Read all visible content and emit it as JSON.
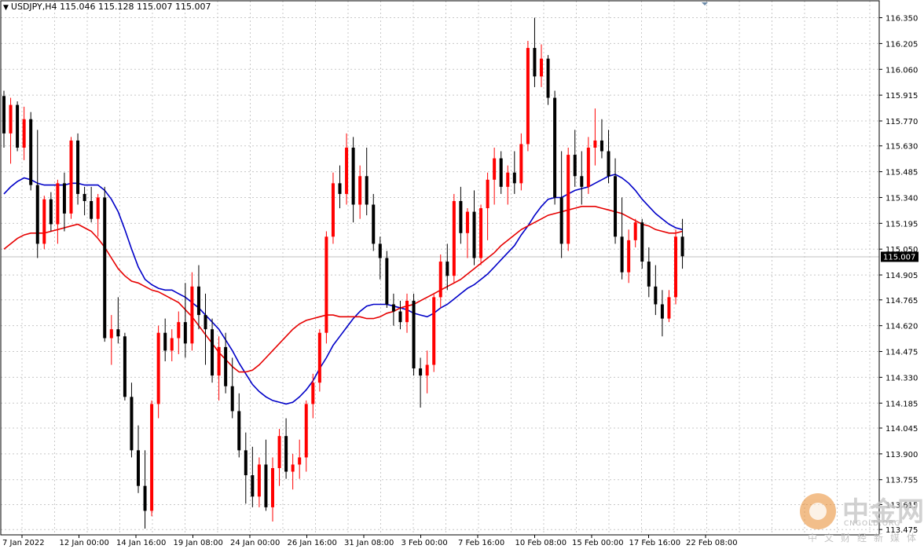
{
  "header": {
    "symbol": "USDJPY,H4",
    "ohlc": "115.046 115.128 115.007 115.007"
  },
  "colors": {
    "bull": "#ff0000",
    "bear": "#000000",
    "ma_fast": "#0000c8",
    "ma_slow": "#e60000",
    "grid": "#c8c8c8",
    "price_line": "#c0c0c0"
  },
  "watermark": {
    "cn": "中金网",
    "en": "CNGOLD.ORG",
    "sub": "中文财经新媒体"
  },
  "chart_data": {
    "type": "candlestick",
    "timeframe": "H4",
    "ylim": [
      113.445,
      116.445
    ],
    "y_ticks": [
      "116.350",
      "116.205",
      "116.060",
      "115.915",
      "115.770",
      "115.630",
      "115.485",
      "115.340",
      "115.195",
      "115.050",
      "114.905",
      "114.765",
      "114.620",
      "114.475",
      "114.330",
      "114.185",
      "114.045",
      "113.900",
      "113.755",
      "113.615",
      "113.475"
    ],
    "x_ticks": [
      "7 Jan 2022",
      "12 Jan 00:00",
      "14 Jan 16:00",
      "19 Jan 08:00",
      "24 Jan 00:00",
      "26 Jan 16:00",
      "31 Jan 08:00",
      "3 Feb 00:00",
      "7 Feb 16:00",
      "10 Feb 08:00",
      "15 Feb 00:00",
      "17 Feb 16:00",
      "22 Feb 08:00"
    ],
    "current_price": "115.007",
    "candles": [
      [
        115.91,
        115.94,
        115.62,
        115.7
      ],
      [
        115.7,
        115.9,
        115.53,
        115.86
      ],
      [
        115.86,
        115.88,
        115.6,
        115.62
      ],
      [
        115.62,
        115.85,
        115.55,
        115.78
      ],
      [
        115.78,
        115.82,
        115.38,
        115.41
      ],
      [
        115.41,
        115.72,
        115.0,
        115.08
      ],
      [
        115.08,
        115.35,
        115.05,
        115.33
      ],
      [
        115.33,
        115.37,
        115.15,
        115.19
      ],
      [
        115.19,
        115.44,
        115.08,
        115.42
      ],
      [
        115.42,
        115.48,
        115.15,
        115.25
      ],
      [
        115.25,
        115.68,
        115.22,
        115.66
      ],
      [
        115.66,
        115.7,
        115.3,
        115.36
      ],
      [
        115.36,
        115.4,
        115.24,
        115.32
      ],
      [
        115.32,
        115.4,
        115.2,
        115.22
      ],
      [
        115.22,
        115.36,
        115.12,
        115.34
      ],
      [
        115.34,
        115.4,
        114.53,
        114.55
      ],
      [
        114.55,
        114.68,
        114.4,
        114.6
      ],
      [
        114.6,
        114.78,
        114.52,
        114.56
      ],
      [
        114.56,
        114.58,
        114.2,
        114.22
      ],
      [
        114.22,
        114.3,
        113.88,
        113.92
      ],
      [
        113.92,
        114.06,
        113.68,
        113.72
      ],
      [
        113.72,
        113.92,
        113.48,
        113.58
      ],
      [
        113.58,
        114.2,
        113.55,
        114.18
      ],
      [
        114.18,
        114.62,
        114.1,
        114.58
      ],
      [
        114.58,
        114.66,
        114.42,
        114.48
      ],
      [
        114.48,
        114.6,
        114.42,
        114.55
      ],
      [
        114.55,
        114.7,
        114.46,
        114.64
      ],
      [
        114.64,
        114.86,
        114.44,
        114.52
      ],
      [
        114.52,
        114.92,
        114.48,
        114.84
      ],
      [
        114.84,
        114.96,
        114.6,
        114.68
      ],
      [
        114.68,
        114.8,
        114.4,
        114.6
      ],
      [
        114.6,
        114.66,
        114.3,
        114.34
      ],
      [
        114.34,
        114.56,
        114.2,
        114.5
      ],
      [
        114.5,
        114.58,
        114.24,
        114.28
      ],
      [
        114.28,
        114.44,
        114.1,
        114.14
      ],
      [
        114.14,
        114.24,
        113.88,
        113.92
      ],
      [
        113.92,
        114.02,
        113.62,
        113.78
      ],
      [
        113.78,
        113.94,
        113.6,
        113.66
      ],
      [
        113.66,
        113.88,
        113.6,
        113.84
      ],
      [
        113.84,
        113.98,
        113.58,
        113.6
      ],
      [
        113.6,
        113.88,
        113.52,
        113.82
      ],
      [
        113.82,
        114.04,
        113.72,
        114.0
      ],
      [
        114.0,
        114.1,
        113.76,
        113.8
      ],
      [
        113.8,
        113.9,
        113.7,
        113.84
      ],
      [
        113.84,
        113.98,
        113.76,
        113.88
      ],
      [
        113.88,
        114.2,
        113.8,
        114.18
      ],
      [
        114.18,
        114.35,
        114.1,
        114.3
      ],
      [
        114.3,
        114.6,
        114.25,
        114.58
      ],
      [
        114.58,
        115.15,
        114.52,
        115.12
      ],
      [
        115.12,
        115.48,
        115.08,
        115.42
      ],
      [
        115.42,
        115.52,
        115.28,
        115.36
      ],
      [
        115.36,
        115.7,
        115.3,
        115.62
      ],
      [
        115.62,
        115.68,
        115.2,
        115.3
      ],
      [
        115.3,
        115.52,
        115.22,
        115.46
      ],
      [
        115.46,
        115.62,
        115.24,
        115.3
      ],
      [
        115.3,
        115.36,
        115.04,
        115.08
      ],
      [
        115.08,
        115.12,
        114.88,
        115.0
      ],
      [
        115.0,
        115.04,
        114.72,
        114.74
      ],
      [
        114.74,
        114.8,
        114.62,
        114.7
      ],
      [
        114.7,
        114.76,
        114.6,
        114.64
      ],
      [
        114.64,
        114.8,
        114.58,
        114.76
      ],
      [
        114.76,
        114.8,
        114.34,
        114.38
      ],
      [
        114.38,
        114.44,
        114.16,
        114.34
      ],
      [
        114.34,
        114.48,
        114.24,
        114.4
      ],
      [
        114.4,
        114.8,
        114.36,
        114.78
      ],
      [
        114.78,
        115.02,
        114.72,
        114.98
      ],
      [
        114.98,
        115.08,
        114.82,
        114.9
      ],
      [
        114.9,
        115.36,
        114.86,
        115.32
      ],
      [
        115.32,
        115.4,
        115.08,
        115.14
      ],
      [
        115.14,
        115.28,
        115.0,
        115.26
      ],
      [
        115.26,
        115.38,
        114.96,
        115.0
      ],
      [
        115.0,
        115.3,
        114.96,
        115.28
      ],
      [
        115.28,
        115.48,
        115.1,
        115.44
      ],
      [
        115.44,
        115.62,
        115.3,
        115.56
      ],
      [
        115.56,
        115.6,
        115.36,
        115.4
      ],
      [
        115.4,
        115.52,
        115.3,
        115.48
      ],
      [
        115.48,
        115.6,
        115.36,
        115.42
      ],
      [
        115.42,
        115.7,
        115.38,
        115.64
      ],
      [
        115.64,
        116.22,
        115.6,
        116.18
      ],
      [
        116.18,
        116.35,
        115.96,
        116.02
      ],
      [
        116.02,
        116.2,
        115.96,
        116.12
      ],
      [
        116.12,
        116.14,
        115.86,
        115.9
      ],
      [
        115.9,
        115.94,
        115.3,
        115.34
      ],
      [
        115.34,
        115.6,
        115.0,
        115.08
      ],
      [
        115.08,
        115.62,
        115.04,
        115.58
      ],
      [
        115.58,
        115.72,
        115.4,
        115.46
      ],
      [
        115.46,
        115.6,
        115.3,
        115.4
      ],
      [
        115.4,
        115.68,
        115.36,
        115.62
      ],
      [
        115.62,
        115.84,
        115.52,
        115.66
      ],
      [
        115.66,
        115.78,
        115.56,
        115.6
      ],
      [
        115.6,
        115.72,
        115.42,
        115.46
      ],
      [
        115.46,
        115.56,
        115.08,
        115.12
      ],
      [
        115.12,
        115.34,
        114.88,
        114.92
      ],
      [
        114.92,
        115.16,
        114.86,
        115.1
      ],
      [
        115.1,
        115.22,
        115.06,
        115.2
      ],
      [
        115.2,
        115.22,
        114.94,
        114.98
      ],
      [
        114.98,
        115.06,
        114.78,
        114.84
      ],
      [
        114.84,
        114.96,
        114.68,
        114.74
      ],
      [
        114.74,
        114.82,
        114.56,
        114.66
      ],
      [
        114.66,
        114.82,
        114.64,
        114.78
      ],
      [
        114.78,
        115.16,
        114.74,
        115.12
      ],
      [
        115.12,
        115.22,
        114.94,
        115.01
      ]
    ],
    "series": [
      {
        "name": "",
        "values": [
          115.36,
          115.4,
          115.43,
          115.45,
          115.44,
          115.42,
          115.41,
          115.41,
          115.41,
          115.41,
          115.42,
          115.42,
          115.41,
          115.41,
          115.41,
          115.38,
          115.33,
          115.26,
          115.16,
          115.05,
          114.95,
          114.88,
          114.85,
          114.83,
          114.82,
          114.82,
          114.8,
          114.78,
          114.75,
          114.72,
          114.68,
          114.64,
          114.6,
          114.54,
          114.48,
          114.41,
          114.35,
          114.29,
          114.25,
          114.22,
          114.2,
          114.19,
          114.18,
          114.19,
          114.22,
          114.26,
          114.31,
          114.38,
          114.44,
          114.51,
          114.56,
          114.61,
          114.66,
          114.7,
          114.73,
          114.74,
          114.74,
          114.74,
          114.73,
          114.72,
          114.71,
          114.69,
          114.68,
          114.67,
          114.69,
          114.72,
          114.74,
          114.77,
          114.8,
          114.83,
          114.85,
          114.88,
          114.91,
          114.95,
          114.99,
          115.03,
          115.07,
          115.13,
          115.18,
          115.24,
          115.29,
          115.33,
          115.34,
          115.34,
          115.36,
          115.38,
          115.39,
          115.4,
          115.42,
          115.44,
          115.46,
          115.47,
          115.45,
          115.42,
          115.38,
          115.33,
          115.29,
          115.25,
          115.22,
          115.19,
          115.17,
          115.16
        ]
      },
      {
        "name": "",
        "values": [
          115.05,
          115.08,
          115.11,
          115.13,
          115.14,
          115.14,
          115.14,
          115.15,
          115.16,
          115.17,
          115.18,
          115.19,
          115.17,
          115.15,
          115.11,
          115.06,
          115.0,
          114.94,
          114.9,
          114.87,
          114.86,
          114.84,
          114.82,
          114.81,
          114.79,
          114.77,
          114.75,
          114.71,
          114.67,
          114.62,
          114.57,
          114.52,
          114.47,
          114.43,
          114.39,
          114.36,
          114.36,
          114.37,
          114.4,
          114.44,
          114.48,
          114.52,
          114.56,
          114.6,
          114.63,
          114.65,
          114.66,
          114.67,
          114.68,
          114.68,
          114.67,
          114.67,
          114.67,
          114.67,
          114.66,
          114.66,
          114.67,
          114.69,
          114.7,
          114.72,
          114.73,
          114.74,
          114.76,
          114.78,
          114.8,
          114.82,
          114.84,
          114.86,
          114.88,
          114.91,
          114.94,
          114.97,
          115.0,
          115.03,
          115.07,
          115.1,
          115.13,
          115.16,
          115.18,
          115.2,
          115.22,
          115.24,
          115.25,
          115.26,
          115.27,
          115.28,
          115.29,
          115.29,
          115.29,
          115.28,
          115.27,
          115.26,
          115.25,
          115.23,
          115.21,
          115.19,
          115.18,
          115.16,
          115.15,
          115.14,
          115.14,
          115.15
        ]
      }
    ]
  }
}
